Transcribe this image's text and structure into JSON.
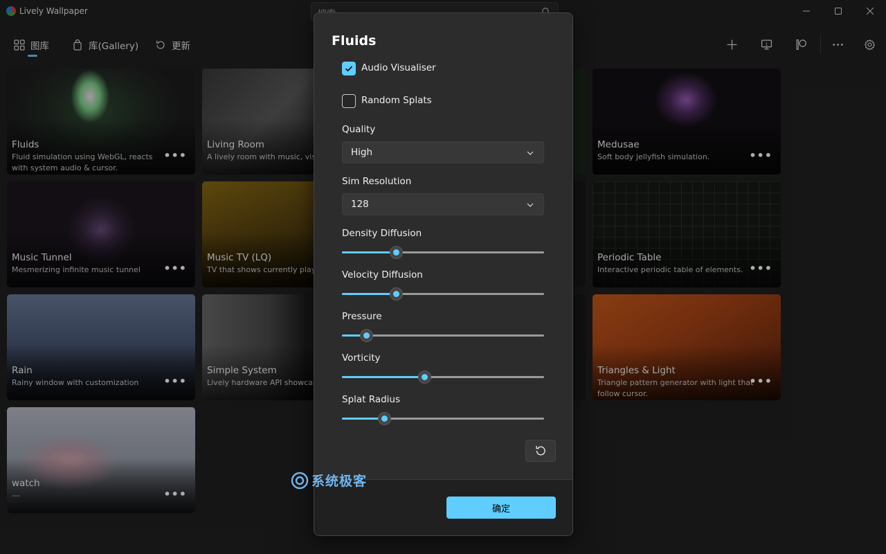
{
  "window": {
    "title": "Lively Wallpaper"
  },
  "search": {
    "placeholder": "搜索"
  },
  "nav": {
    "items": [
      {
        "label": "图库",
        "icon": "grid-icon"
      },
      {
        "label": "库(Gallery)",
        "icon": "bag-icon"
      },
      {
        "label": "更新",
        "icon": "refresh-icon"
      }
    ]
  },
  "toolbar": {
    "icons": [
      "add-icon",
      "monitor-icon",
      "patreon-icon",
      "more-icon",
      "settings-icon"
    ]
  },
  "cards": [
    {
      "title": "Fluids",
      "desc": "Fluid simulation using WebGL, reacts with system audio & cursor."
    },
    {
      "title": "Living Room",
      "desc": "A lively room with music, visu more!"
    },
    {
      "title": "Medusae",
      "desc": "Soft body jellyfish simulation."
    },
    {
      "title": "Music Tunnel",
      "desc": "Mesmerizing infinite music tunnel"
    },
    {
      "title": "Music TV (LQ)",
      "desc": "TV that shows currently playin"
    },
    {
      "title": "Periodic Table",
      "desc": "Interactive periodic table of elements."
    },
    {
      "title": "Rain",
      "desc": "Rainy window with customization"
    },
    {
      "title": "Simple System",
      "desc": "Lively hardware API showcase"
    },
    {
      "title": "Triangles & Light",
      "desc": "Triangle pattern generator with light that follow cursor."
    },
    {
      "title": "watch",
      "desc": "---"
    }
  ],
  "dialog": {
    "title": "Fluids",
    "audio_visualiser": {
      "label": "Audio Visualiser",
      "checked": true
    },
    "random_splats": {
      "label": "Random Splats",
      "checked": false
    },
    "quality": {
      "label": "Quality",
      "value": "High"
    },
    "sim_resolution": {
      "label": "Sim Resolution",
      "value": "128"
    },
    "sliders": [
      {
        "label": "Density Diffusion",
        "value": 0.27
      },
      {
        "label": "Velocity Diffusion",
        "value": 0.27
      },
      {
        "label": "Pressure",
        "value": 0.12
      },
      {
        "label": "Vorticity",
        "value": 0.41
      },
      {
        "label": "Splat Radius",
        "value": 0.21
      }
    ],
    "ok_label": "确定"
  },
  "watermark": {
    "text": "系统极客"
  },
  "colors": {
    "accent": "#60cdff",
    "background": "#202020",
    "dialog": "#2c2c2c"
  }
}
